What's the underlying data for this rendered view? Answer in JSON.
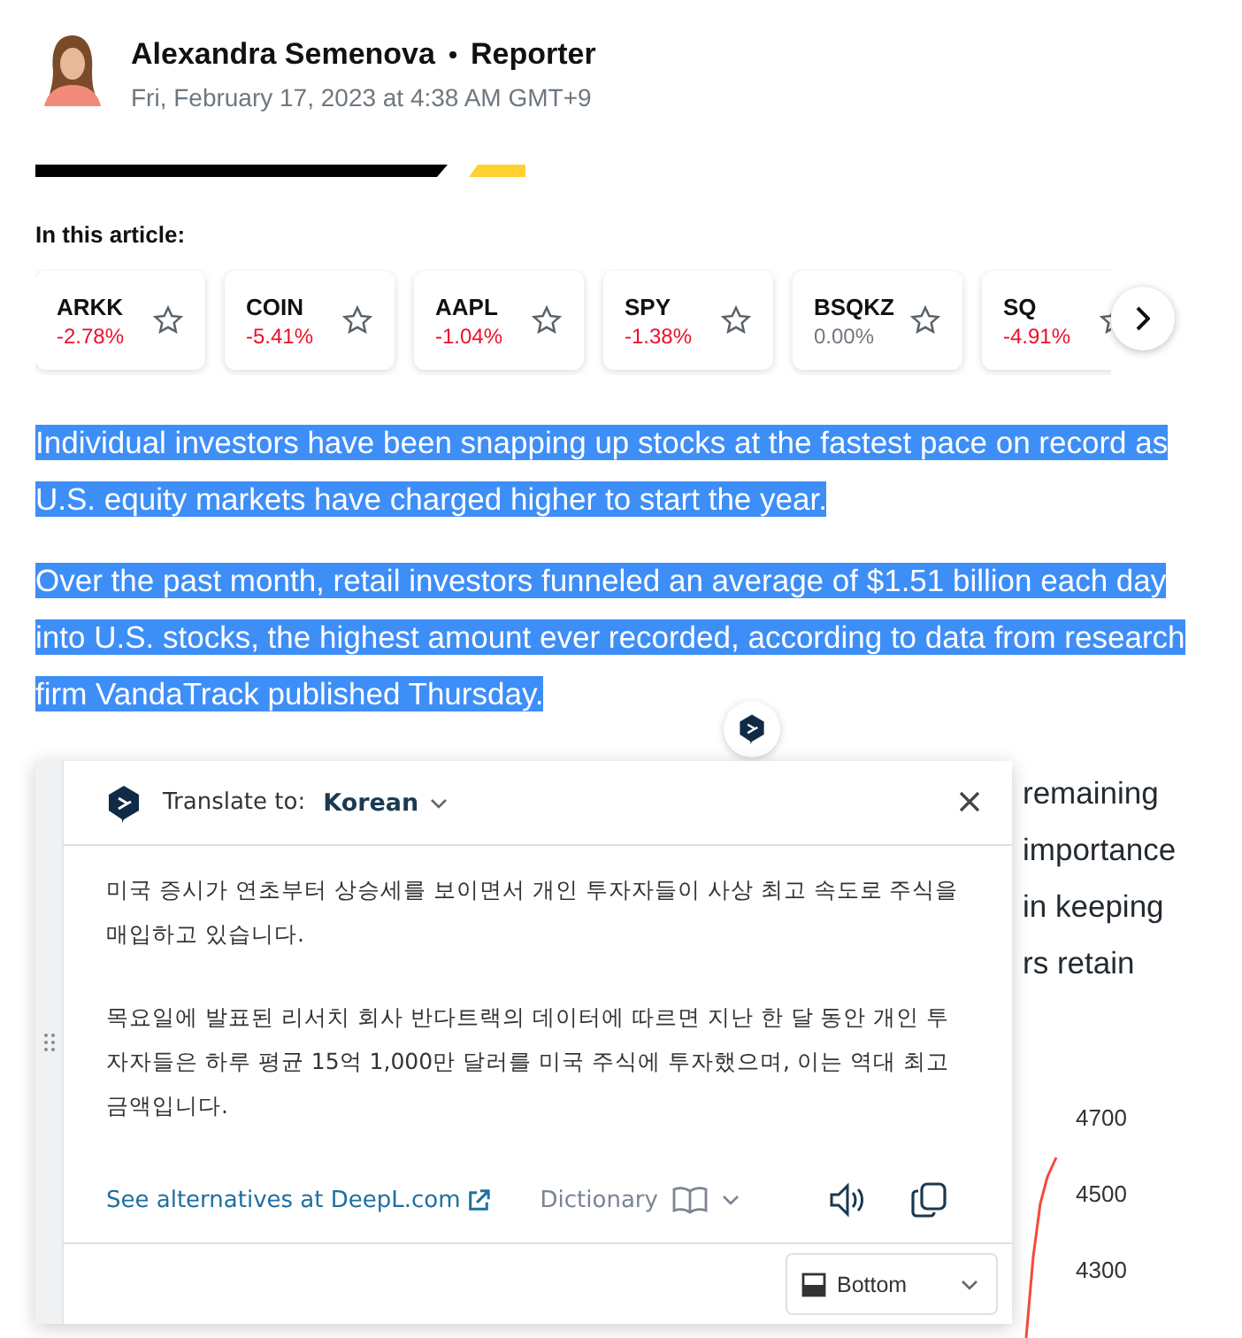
{
  "author": {
    "name": "Alexandra Semenova",
    "role": "Reporter",
    "date": "Fri, February 17, 2023 at 4:38 AM GMT+9"
  },
  "tickers_heading": "In this article:",
  "tickers": [
    {
      "symbol": "ARKK",
      "change": "-2.78%",
      "color": "#eb0f29"
    },
    {
      "symbol": "COIN",
      "change": "-5.41%",
      "color": "#eb0f29"
    },
    {
      "symbol": "AAPL",
      "change": "-1.04%",
      "color": "#eb0f29"
    },
    {
      "symbol": "SPY",
      "change": "-1.38%",
      "color": "#eb0f29"
    },
    {
      "symbol": "BSQKZ",
      "change": "0.00%",
      "color": "#6e7780"
    },
    {
      "symbol": "SQ",
      "change": "-4.91%",
      "color": "#eb0f29"
    }
  ],
  "paragraphs": [
    {
      "text": "Individual investors have been snapping up stocks at the fastest pace on record as U.S. equity markets have charged higher to start the year.",
      "selected": true
    },
    {
      "text": "Over the past month, retail investors funneled an average of $1.51 billion each day into U.S. stocks, the highest amount ever recorded, according to data from research firm VandaTrack published Thursday.",
      "selected": true
    }
  ],
  "covered_paragraph_fragments": [
    "remaining",
    "importance",
    "in keeping",
    "rs retain"
  ],
  "chart_axis_labels": [
    "4700",
    "4500",
    "4300"
  ],
  "translator": {
    "label": "Translate to:",
    "language": "Korean",
    "paragraphs": [
      "미국 증시가 연초부터 상승세를 보이면서 개인 투자자들이 사상 최고 속도로 주식을 매입하고 있습니다.",
      "목요일에 발표된 리서치 회사 반다트랙의 데이터에 따르면 지난 한 달 동안 개인 투자자들은 하루 평균 15억 1,000만 달러를 미국 주식에 투자했으며, 이는 역대 최고 금액입니다."
    ],
    "alternatives_link": "See alternatives at DeepL.com",
    "dictionary": "Dictionary",
    "position": "Bottom"
  }
}
